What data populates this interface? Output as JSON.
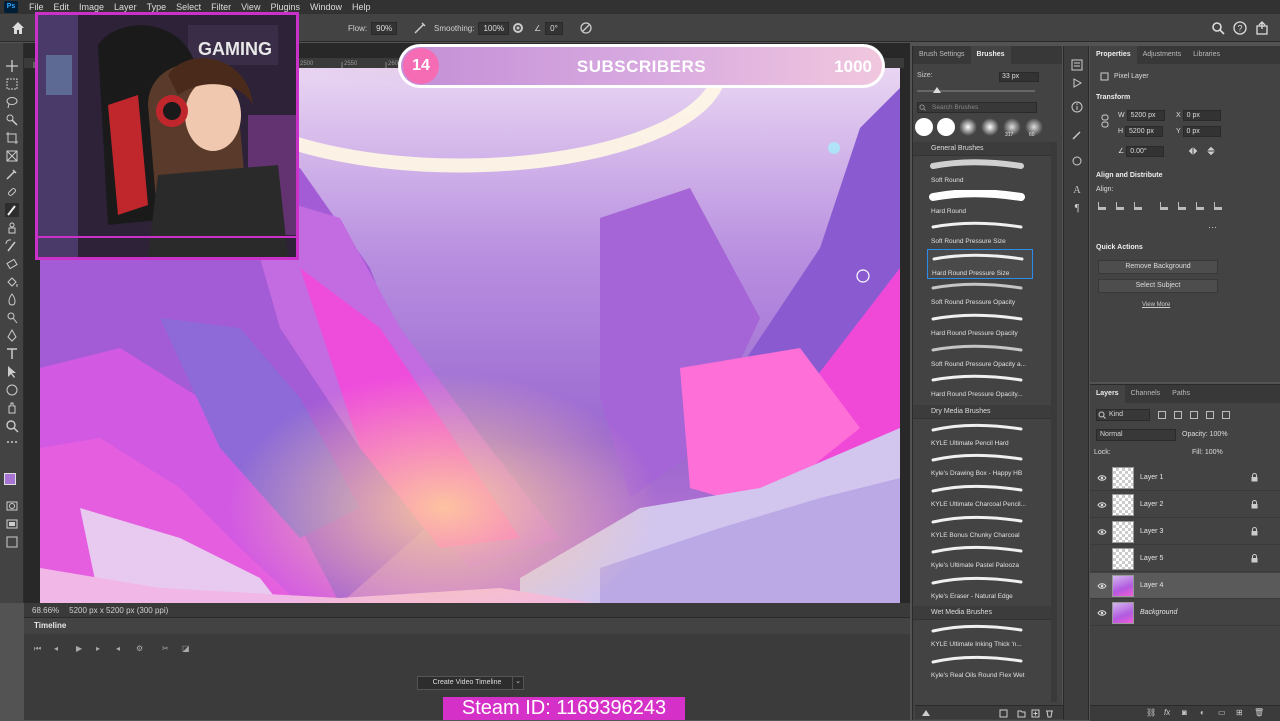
{
  "menu": [
    "File",
    "Edit",
    "Image",
    "Layer",
    "Type",
    "Select",
    "Filter",
    "View",
    "Plugins",
    "Window",
    "Help"
  ],
  "app_logo": "Ps",
  "options": {
    "flow_label": "Flow:",
    "flow_value": "90%",
    "smoothing_label": "Smoothing:",
    "smoothing_value": "100%",
    "angle_value": "0°"
  },
  "status": {
    "zoom": "68.66%",
    "doc_info": "5200 px x 5200 px (300 ppi)"
  },
  "ruler_ticks": [
    "2200",
    "2250",
    "2300",
    "2350",
    "2400",
    "2450",
    "2500",
    "2550",
    "2600",
    "2650",
    "2700",
    "2750",
    "2800",
    "2850",
    "2900",
    "2950",
    "3000",
    "3050",
    "3100"
  ],
  "timeline": {
    "title": "Timeline",
    "create_button": "Create Video Timeline"
  },
  "brushes_panel": {
    "tabs": [
      "Brush Settings",
      "Brushes"
    ],
    "size_label": "Size:",
    "size_value": "33 px",
    "search_placeholder": "Search Brushes",
    "preset_sizes": [
      "317",
      "60"
    ],
    "groups": [
      {
        "name": "General Brushes",
        "items": [
          "Soft Round",
          "Hard Round",
          "Soft Round Pressure Size",
          "Hard Round Pressure Size",
          "Soft Round Pressure Opacity",
          "Hard Round Pressure Opacity",
          "Soft Round Pressure Opacity a...",
          "Hard Round Pressure Opacity..."
        ]
      },
      {
        "name": "Dry Media Brushes",
        "items": [
          "KYLE Ultimate Pencil Hard",
          "Kyle's Drawing Box - Happy HB",
          "KYLE Ultimate Charcoal Pencil...",
          "KYLE Bonus Chunky Charcoal",
          "Kyle's Ultimate Pastel Palooza",
          "Kyle's Eraser - Natural Edge"
        ]
      },
      {
        "name": "Wet Media Brushes",
        "items": [
          "KYLE Ultimate Inking Thick 'n...",
          "Kyle's Real Oils Round Flex Wet"
        ]
      }
    ]
  },
  "properties": {
    "tabs": [
      "Properties",
      "Adjustments",
      "Libraries"
    ],
    "kind": "Pixel Layer",
    "transform_title": "Transform",
    "w_label": "W",
    "w_value": "5200 px",
    "h_label": "H",
    "h_value": "5200 px",
    "x_label": "X",
    "x_value": "0 px",
    "y_label": "Y",
    "y_value": "0 px",
    "angle_value": "0.00°",
    "align_title": "Align and Distribute",
    "align_label": "Align:",
    "quick_actions_title": "Quick Actions",
    "remove_bg": "Remove Background",
    "select_subject": "Select Subject",
    "view_more": "View More"
  },
  "layers_panel": {
    "tabs": [
      "Layers",
      "Channels",
      "Paths"
    ],
    "kind_label": "Kind",
    "blend_mode": "Normal",
    "opacity_label": "Opacity:",
    "opacity_value": "100%",
    "lock_label": "Lock:",
    "fill_label": "Fill:",
    "fill_value": "100%",
    "layers": [
      "Layer 1",
      "Layer 2",
      "Layer 3",
      "Layer 5",
      "Layer 4",
      "Background"
    ]
  },
  "overlay": {
    "subscriber_count": "14",
    "subscriber_label": "SUBSCRIBERS",
    "subscriber_goal": "1000",
    "steam_id": "Steam ID: 1169396243",
    "webcam_sign": "GAMING"
  },
  "colors": {
    "accent_blue": "#2d8ceb",
    "overlay_pink": "#f56bb4",
    "steam_bar": "#d531c8",
    "webcam_border": "#c931c9"
  },
  "icons": [
    "home-icon",
    "brush-tool-icon",
    "search-icon",
    "gear-icon",
    "share-icon",
    "eye-icon",
    "lock-icon",
    "pressure-icon"
  ]
}
